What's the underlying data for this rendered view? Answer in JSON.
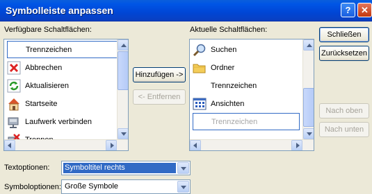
{
  "window": {
    "title": "Symbolleiste anpassen",
    "help_label": "?",
    "close_label": "✕"
  },
  "available": {
    "label": "Verfügbare Schaltflächen:",
    "items": [
      {
        "label": "Trennzeichen",
        "icon": "separator"
      },
      {
        "label": "Abbrechen",
        "icon": "cancel-icon"
      },
      {
        "label": "Aktualisieren",
        "icon": "refresh-icon"
      },
      {
        "label": "Startseite",
        "icon": "home-icon"
      },
      {
        "label": "Laufwerk verbinden",
        "icon": "map-drive-icon"
      },
      {
        "label": "Trennen",
        "icon": "disconnect-icon"
      }
    ]
  },
  "current": {
    "label": "Aktuelle Schaltflächen:",
    "items": [
      {
        "label": "Suchen",
        "icon": "search-icon"
      },
      {
        "label": "Ordner",
        "icon": "folder-icon"
      },
      {
        "label": "Trennzeichen",
        "icon": "separator"
      },
      {
        "label": "Ansichten",
        "icon": "views-icon"
      },
      {
        "label": "Trennzeichen",
        "icon": "separator"
      }
    ]
  },
  "buttons": {
    "add": "Hinzufügen ->",
    "remove": "<- Entfernen",
    "close": "Schließen",
    "reset": "Zurücksetzen",
    "move_up": "Nach oben",
    "move_down": "Nach unten"
  },
  "text_options": {
    "label": "Textoptionen:",
    "value": "Symboltitel rechts"
  },
  "icon_options": {
    "label": "Symboloptionen:",
    "value": "Große Symbole"
  }
}
